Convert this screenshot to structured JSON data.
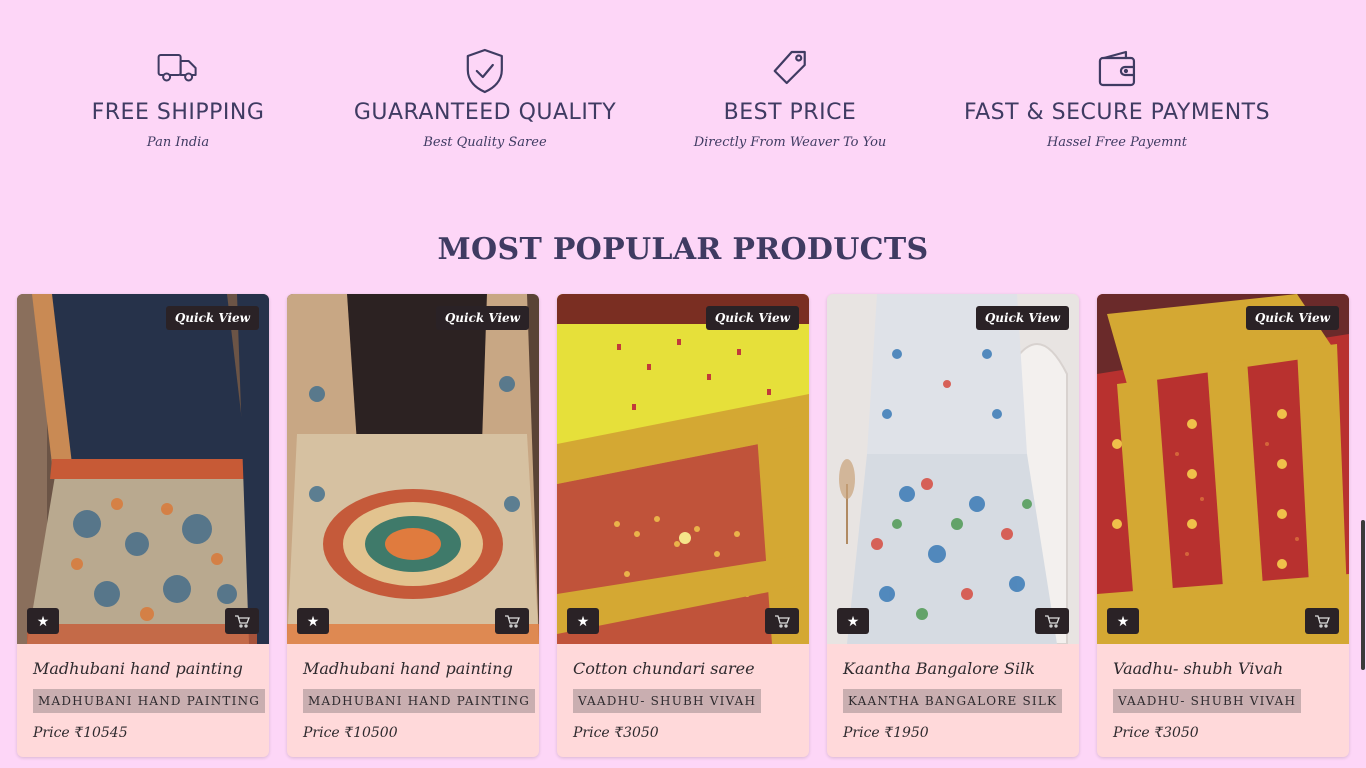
{
  "features": [
    {
      "icon": "truck-icon",
      "title": "FREE SHIPPING",
      "subtitle": "Pan India"
    },
    {
      "icon": "shield-check-icon",
      "title": "GUARANTEED QUALITY",
      "subtitle": "Best Quality Saree"
    },
    {
      "icon": "price-tag-icon",
      "title": "BEST PRICE",
      "subtitle": "Directly From Weaver To You"
    },
    {
      "icon": "wallet-icon",
      "title": "FAST & SECURE PAYMENTS",
      "subtitle": "Hassel Free Payemnt"
    }
  ],
  "section": {
    "title": "MOST POPULAR PRODUCTS"
  },
  "products": [
    {
      "name": "Madhubani hand painting",
      "category": "MADHUBANI HAND PAINTING",
      "price": "Price ₹10545",
      "quick_view": "Quick View",
      "wishlist_icon": "star-icon",
      "cart_icon": "cart-icon"
    },
    {
      "name": "Madhubani hand painting",
      "category": "MADHUBANI HAND PAINTING",
      "price": "Price ₹10500",
      "quick_view": "Quick View",
      "wishlist_icon": "star-icon",
      "cart_icon": "cart-icon"
    },
    {
      "name": "Cotton chundari saree",
      "category": "VAADHU- SHUBH VIVAH",
      "price": "Price ₹3050",
      "quick_view": "Quick View",
      "wishlist_icon": "star-icon",
      "cart_icon": "cart-icon"
    },
    {
      "name": "Kaantha Bangalore Silk",
      "category": "KAANTHA BANGALORE SILK",
      "price": "Price ₹1950",
      "quick_view": "Quick View",
      "wishlist_icon": "star-icon",
      "cart_icon": "cart-icon"
    },
    {
      "name": "Vaadhu- shubh Vivah",
      "category": "VAADHU- SHUBH VIVAH",
      "price": "Price ₹3050",
      "quick_view": "Quick View",
      "wishlist_icon": "star-icon",
      "cart_icon": "cart-icon"
    }
  ],
  "colors": {
    "page_background": "#fdd6f7",
    "text_primary": "#3f3b62",
    "card_background": "#ffd9da",
    "tag_background": "#c9aeb0",
    "button_dark": "#2a2226"
  }
}
